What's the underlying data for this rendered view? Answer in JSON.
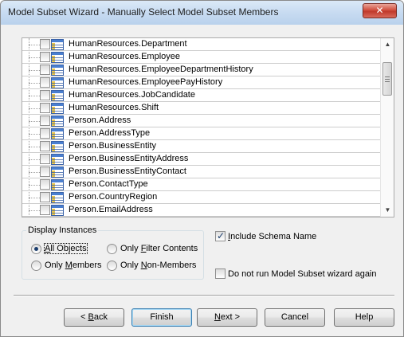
{
  "window": {
    "title": "Model Subset Wizard - Manually Select Model Subset Members",
    "close_glyph": "✕"
  },
  "list": {
    "items": [
      {
        "label": "HumanResources.Department",
        "checked": false
      },
      {
        "label": "HumanResources.Employee",
        "checked": false
      },
      {
        "label": "HumanResources.EmployeeDepartmentHistory",
        "checked": false
      },
      {
        "label": "HumanResources.EmployeePayHistory",
        "checked": false
      },
      {
        "label": "HumanResources.JobCandidate",
        "checked": false
      },
      {
        "label": "HumanResources.Shift",
        "checked": false
      },
      {
        "label": "Person.Address",
        "checked": false
      },
      {
        "label": "Person.AddressType",
        "checked": false
      },
      {
        "label": "Person.BusinessEntity",
        "checked": false
      },
      {
        "label": "Person.BusinessEntityAddress",
        "checked": false
      },
      {
        "label": "Person.BusinessEntityContact",
        "checked": false
      },
      {
        "label": "Person.ContactType",
        "checked": false
      },
      {
        "label": "Person.CountryRegion",
        "checked": false
      },
      {
        "label": "Person.EmailAddress",
        "checked": false
      }
    ],
    "item_icon": "table-icon",
    "scroll_up_glyph": "▲",
    "scroll_down_glyph": "▼"
  },
  "display_instances": {
    "legend": "Display Instances",
    "options": [
      {
        "label_pre": "",
        "mnemonic": "A",
        "label_post": "ll Objects",
        "selected": true
      },
      {
        "label_pre": "Only ",
        "mnemonic": "F",
        "label_post": "ilter Contents",
        "selected": false
      },
      {
        "label_pre": "Only ",
        "mnemonic": "M",
        "label_post": "embers",
        "selected": false
      },
      {
        "label_pre": "Only ",
        "mnemonic": "N",
        "label_post": "on-Members",
        "selected": false
      }
    ]
  },
  "options": {
    "include_schema": {
      "mnemonic": "I",
      "label_post": "nclude Schema Name",
      "checked": true
    },
    "do_not_run": {
      "label": "Do not run Model Subset wizard again",
      "checked": false
    }
  },
  "buttons": {
    "back": {
      "pre": "< ",
      "mnemonic": "B",
      "post": "ack"
    },
    "finish": {
      "label": "Finish"
    },
    "next": {
      "mnemonic": "N",
      "post": "ext >"
    },
    "cancel": {
      "label": "Cancel"
    },
    "help": {
      "label": "Help"
    }
  }
}
